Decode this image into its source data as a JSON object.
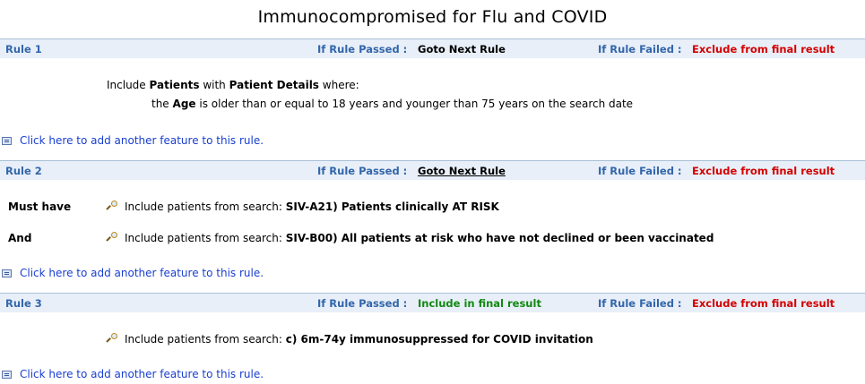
{
  "title": "Immunocompromised for Flu and COVID",
  "labels": {
    "if_passed": "If Rule Passed :",
    "if_failed": "If Rule Failed :",
    "add_feature": "Click here to add another feature to this rule.",
    "include_from_search": "Include patients from search:"
  },
  "rules": [
    {
      "name": "Rule 1",
      "passed_action": "Goto Next Rule",
      "failed_action": "Exclude from final result",
      "description": {
        "include": "Include",
        "patients": "Patients",
        "with": "with",
        "patient_details": "Patient Details",
        "where": "where:",
        "the": "the",
        "age": "Age",
        "criteria": "is older than or equal to 18 years and younger than 75 years on the search date"
      }
    },
    {
      "name": "Rule 2",
      "passed_action": "Goto Next Rule",
      "failed_action": "Exclude from final result",
      "conditions": [
        {
          "label": "Must have",
          "search": "SIV-A21) Patients clinically AT RISK"
        },
        {
          "label": "And",
          "search": "SIV-B00) All patients at risk who have not declined or been vaccinated"
        }
      ]
    },
    {
      "name": "Rule 3",
      "passed_action": "Include in final result",
      "failed_action": "Exclude from final result",
      "conditions": [
        {
          "label": "",
          "search": "c) 6m-74y immunosuppressed for COVID invitation"
        }
      ]
    }
  ],
  "colors": {
    "header_bg": "#e8eff8",
    "header_text": "#3366aa",
    "failed_action": "#d40000",
    "include_action": "#118811",
    "link": "#1a3fd0"
  }
}
